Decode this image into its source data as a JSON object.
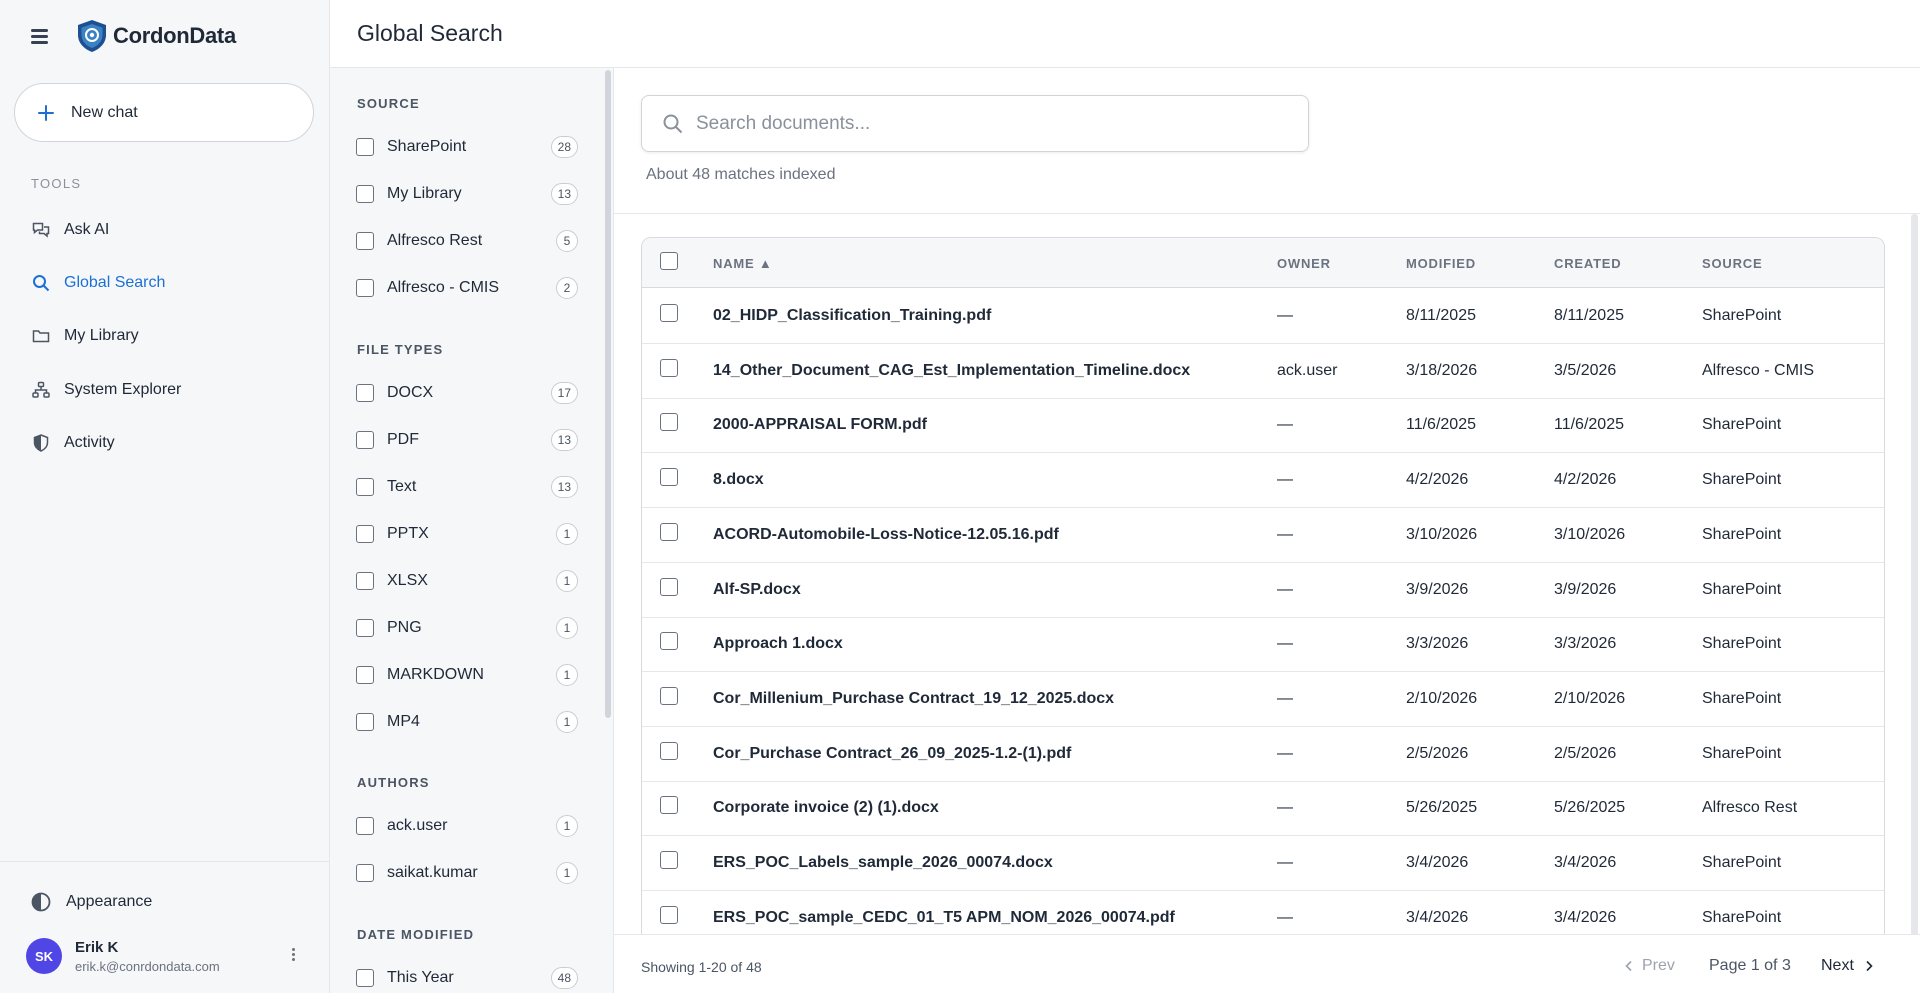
{
  "app": {
    "brand": "CordonData"
  },
  "sidebar": {
    "new_chat_label": "New chat",
    "tools_heading": "TOOLS",
    "items": [
      {
        "label": "Ask AI",
        "icon": "chat-bubbles-icon",
        "active": false
      },
      {
        "label": "Global Search",
        "icon": "search-icon",
        "active": true
      },
      {
        "label": "My Library",
        "icon": "folder-icon",
        "active": false
      },
      {
        "label": "System Explorer",
        "icon": "network-icon",
        "active": false
      },
      {
        "label": "Activity",
        "icon": "shield-icon",
        "active": false
      }
    ],
    "appearance_label": "Appearance",
    "user": {
      "initials": "SK",
      "name": "Erik K",
      "email": "erik.k@conrdondata.com"
    }
  },
  "header": {
    "title": "Global Search"
  },
  "filters": {
    "source": {
      "heading": "SOURCE",
      "options": [
        {
          "label": "SharePoint",
          "count": "28"
        },
        {
          "label": "My Library",
          "count": "13"
        },
        {
          "label": "Alfresco Rest",
          "count": "5"
        },
        {
          "label": "Alfresco - CMIS",
          "count": "2"
        }
      ]
    },
    "file_types": {
      "heading": "FILE TYPES",
      "options": [
        {
          "label": "DOCX",
          "count": "17"
        },
        {
          "label": "PDF",
          "count": "13"
        },
        {
          "label": "Text",
          "count": "13"
        },
        {
          "label": "PPTX",
          "count": "1"
        },
        {
          "label": "XLSX",
          "count": "1"
        },
        {
          "label": "PNG",
          "count": "1"
        },
        {
          "label": "MARKDOWN",
          "count": "1"
        },
        {
          "label": "MP4",
          "count": "1"
        }
      ]
    },
    "authors": {
      "heading": "AUTHORS",
      "options": [
        {
          "label": "ack.user",
          "count": "1"
        },
        {
          "label": "saikat.kumar",
          "count": "1"
        }
      ]
    },
    "date_modified": {
      "heading": "DATE MODIFIED",
      "options": [
        {
          "label": "This Year",
          "count": "48"
        }
      ]
    }
  },
  "search": {
    "placeholder": "Search documents...",
    "value": "",
    "matches_text": "About 48 matches indexed"
  },
  "table": {
    "columns": {
      "name": "NAME ▲",
      "owner": "OWNER",
      "modified": "MODIFIED",
      "created": "CREATED",
      "source": "SOURCE"
    },
    "rows": [
      {
        "name": "02_HIDP_Classification_Training.pdf",
        "owner": "—",
        "modified": "8/11/2025",
        "created": "8/11/2025",
        "source": "SharePoint"
      },
      {
        "name": "14_Other_Document_CAG_Est_Implementation_Timeline.docx",
        "owner": "ack.user",
        "modified": "3/18/2026",
        "created": "3/5/2026",
        "source": "Alfresco - CMIS"
      },
      {
        "name": "2000-APPRAISAL FORM.pdf",
        "owner": "—",
        "modified": "11/6/2025",
        "created": "11/6/2025",
        "source": "SharePoint"
      },
      {
        "name": "8.docx",
        "owner": "—",
        "modified": "4/2/2026",
        "created": "4/2/2026",
        "source": "SharePoint"
      },
      {
        "name": "ACORD-Automobile-Loss-Notice-12.05.16.pdf",
        "owner": "—",
        "modified": "3/10/2026",
        "created": "3/10/2026",
        "source": "SharePoint"
      },
      {
        "name": "Alf-SP.docx",
        "owner": "—",
        "modified": "3/9/2026",
        "created": "3/9/2026",
        "source": "SharePoint"
      },
      {
        "name": "Approach 1.docx",
        "owner": "—",
        "modified": "3/3/2026",
        "created": "3/3/2026",
        "source": "SharePoint"
      },
      {
        "name": "Cor_Millenium_Purchase Contract_19_12_2025.docx",
        "owner": "—",
        "modified": "2/10/2026",
        "created": "2/10/2026",
        "source": "SharePoint"
      },
      {
        "name": "Cor_Purchase Contract_26_09_2025-1.2-(1).pdf",
        "owner": "—",
        "modified": "2/5/2026",
        "created": "2/5/2026",
        "source": "SharePoint"
      },
      {
        "name": "Corporate invoice (2) (1).docx",
        "owner": "—",
        "modified": "5/26/2025",
        "created": "5/26/2025",
        "source": "Alfresco Rest"
      },
      {
        "name": "ERS_POC_Labels_sample_2026_00074.docx",
        "owner": "—",
        "modified": "3/4/2026",
        "created": "3/4/2026",
        "source": "SharePoint"
      },
      {
        "name": "ERS_POC_sample_CEDC_01_T5 APM_NOM_2026_00074.pdf",
        "owner": "—",
        "modified": "3/4/2026",
        "created": "3/4/2026",
        "source": "SharePoint"
      }
    ]
  },
  "footer": {
    "showing": "Showing 1-20 of 48",
    "prev_label": "Prev",
    "page_info": "Page 1 of 3",
    "next_label": "Next"
  },
  "colors": {
    "accent": "#1d6fd6",
    "avatar": "#4f46e5",
    "sidebar_bg": "#f6f7f9"
  }
}
